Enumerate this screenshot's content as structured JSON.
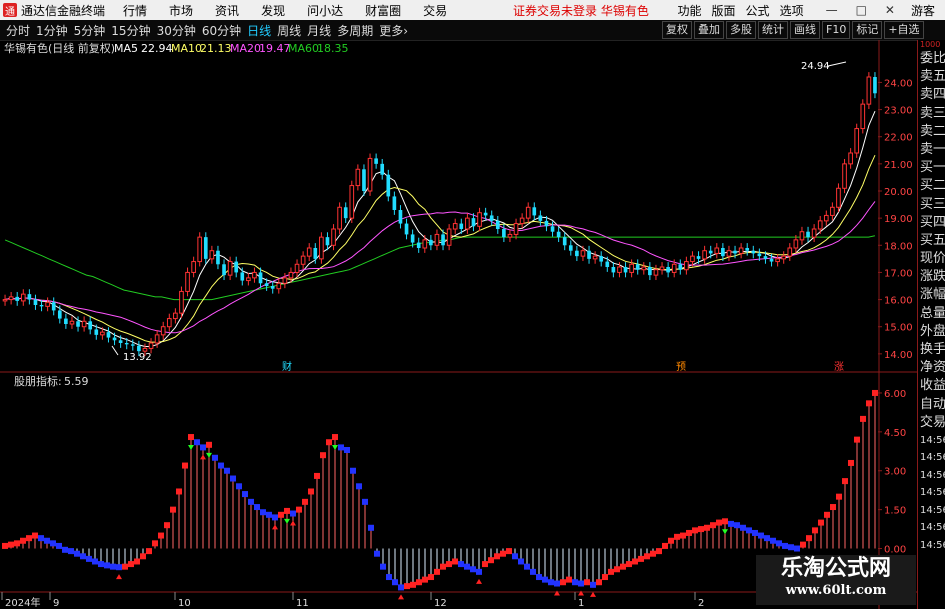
{
  "app": {
    "name": "通达信金融终端",
    "logo": "通"
  },
  "menu": [
    "行情",
    "市场",
    "资讯",
    "发现",
    "问小达",
    "财富圈",
    "交易"
  ],
  "notice": "证券交易未登录  华锡有色",
  "right_menu": [
    "功能",
    "版面",
    "公式",
    "选项"
  ],
  "window_controls": [
    "—",
    "□",
    "✕"
  ],
  "guest": "游客",
  "periods": [
    "分时",
    "1分钟",
    "5分钟",
    "15分钟",
    "30分钟",
    "60分钟",
    "日线",
    "周线",
    "月线",
    "多周期",
    "更多›"
  ],
  "active_period": "日线",
  "tool_buttons": [
    "复权",
    "叠加",
    "多股",
    "统计",
    "画线",
    "F10",
    "标记",
    "+自选"
  ],
  "sidebar": [
    "委比",
    "卖五",
    "卖四",
    "卖三",
    "卖二",
    "卖一",
    "买一",
    "买二",
    "买三",
    "买四",
    "买五",
    "现价",
    "涨跌",
    "涨幅",
    "总量",
    "外盘",
    "换手",
    "净资",
    "收益",
    "自动",
    "交易",
    "14:56",
    "14:56",
    "14:56",
    "14:56",
    "14:56",
    "14:56",
    "14:56"
  ],
  "sidebar_top": "1000",
  "watermark": {
    "line1": "乐淘公式网",
    "line2": "www.60lt.com"
  },
  "colors": {
    "up": "#ff3333",
    "down": "#22ddff",
    "ma5": "#ffffff",
    "ma10": "#ffff66",
    "ma20": "#ff55ff",
    "ma60": "#22cc22",
    "frame": "#8a1a1a",
    "blue_bar": "#2233ff",
    "green_arrow": "#22ff22"
  },
  "chart_data": [
    {
      "type": "candlestick",
      "title": "华锡有色(日线 前复权)",
      "legend": [
        {
          "name": "MA5",
          "value": "22.94"
        },
        {
          "name": "MA10",
          "value": "21.13"
        },
        {
          "name": "MA20",
          "value": "19.47"
        },
        {
          "name": "MA60",
          "value": "18.35"
        }
      ],
      "y_ticks": [
        "24.00",
        "23.00",
        "22.00",
        "21.00",
        "20.00",
        "19.00",
        "18.00",
        "17.00",
        "16.00",
        "15.00",
        "14.00"
      ],
      "ylim": [
        13.7,
        24.9
      ],
      "annotations": {
        "high": "24.94",
        "low": "13.92",
        "markers": [
          "财",
          "预",
          "涨"
        ]
      },
      "close": [
        16.0,
        16.1,
        15.95,
        16.2,
        16.0,
        15.8,
        15.75,
        15.9,
        15.6,
        15.3,
        15.1,
        15.2,
        15.0,
        15.2,
        14.9,
        14.7,
        14.8,
        14.6,
        14.5,
        14.4,
        14.35,
        14.3,
        14.1,
        14.2,
        14.4,
        14.7,
        15.0,
        15.3,
        15.5,
        16.3,
        17.0,
        17.4,
        18.3,
        17.5,
        17.8,
        17.3,
        16.9,
        17.4,
        17.0,
        16.7,
        16.8,
        17.0,
        16.6,
        16.5,
        16.4,
        16.6,
        16.8,
        17.0,
        17.3,
        17.6,
        17.9,
        17.5,
        18.3,
        18.0,
        18.6,
        19.4,
        19.0,
        20.2,
        20.8,
        20.0,
        21.2,
        21.0,
        20.6,
        19.8,
        19.3,
        18.8,
        18.4,
        18.1,
        17.9,
        18.2,
        18.0,
        18.4,
        18.0,
        18.6,
        18.8,
        18.6,
        19.0,
        18.7,
        19.2,
        19.1,
        18.9,
        18.6,
        18.3,
        18.4,
        18.8,
        19.0,
        19.4,
        19.1,
        18.9,
        18.7,
        18.5,
        18.3,
        18.0,
        17.8,
        17.6,
        17.8,
        17.5,
        17.6,
        17.4,
        17.2,
        17.0,
        17.2,
        17.0,
        17.3,
        17.1,
        17.2,
        16.9,
        17.1,
        17.2,
        17.0,
        17.3,
        17.1,
        17.4,
        17.6,
        17.5,
        17.8,
        17.7,
        17.9,
        17.6,
        17.8,
        17.7,
        17.9,
        17.8,
        17.7,
        17.6,
        17.5,
        17.4,
        17.5,
        17.6,
        17.9,
        18.2,
        18.5,
        18.3,
        18.6,
        18.9,
        19.1,
        19.4,
        20.1,
        21.0,
        21.4,
        22.3,
        23.2,
        24.2,
        23.6
      ],
      "ma60": [
        18.2,
        18.1,
        18.0,
        17.9,
        17.8,
        17.7,
        17.6,
        17.5,
        17.4,
        17.3,
        17.2,
        17.1,
        17.0,
        16.9,
        16.85,
        16.75,
        16.65,
        16.55,
        16.45,
        16.35,
        16.3,
        16.25,
        16.2,
        16.15,
        16.1,
        16.1,
        16.05,
        16.0,
        16.0,
        16.0,
        16.0,
        16.0,
        16.0,
        16.0,
        16.05,
        16.1,
        16.15,
        16.2,
        16.25,
        16.3,
        16.35,
        16.4,
        16.45,
        16.5,
        16.55,
        16.6,
        16.65,
        16.7,
        16.75,
        16.8,
        16.85,
        16.9,
        16.95,
        17.0,
        17.05,
        17.1,
        17.2,
        17.3,
        17.4,
        17.5,
        17.6,
        17.7,
        17.8,
        17.9,
        17.95,
        18.0,
        18.05,
        18.1,
        18.1,
        18.15,
        18.2,
        18.2,
        18.25,
        18.3,
        18.3,
        18.3,
        18.3,
        18.3,
        18.3,
        18.3,
        18.3,
        18.3,
        18.3,
        18.3,
        18.3,
        18.3,
        18.3,
        18.3,
        18.3,
        18.3,
        18.3,
        18.3,
        18.3,
        18.3,
        18.3,
        18.3,
        18.3,
        18.3,
        18.3,
        18.3,
        18.3,
        18.3,
        18.3,
        18.3,
        18.3,
        18.3,
        18.3,
        18.3,
        18.3,
        18.3,
        18.3,
        18.3,
        18.3,
        18.3,
        18.3,
        18.3,
        18.3,
        18.3,
        18.3,
        18.3,
        18.3,
        18.3,
        18.3,
        18.3,
        18.3,
        18.3,
        18.3,
        18.3,
        18.3,
        18.3,
        18.3,
        18.3,
        18.3,
        18.3,
        18.3,
        18.3,
        18.3,
        18.3,
        18.3,
        18.35
      ]
    },
    {
      "type": "bar",
      "title": "股朋指标",
      "value": "5.59",
      "y_ticks": [
        "6.00",
        "4.50",
        "3.00",
        "1.50",
        "0.00"
      ],
      "ylim": [
        -1.6,
        6.5
      ],
      "x_labels": [
        "2024年",
        "9",
        "10",
        "11",
        "12",
        "1",
        "2"
      ],
      "values": [
        0.1,
        0.15,
        0.2,
        0.3,
        0.4,
        0.5,
        0.4,
        0.3,
        0.2,
        0.1,
        -0.05,
        -0.1,
        -0.2,
        -0.3,
        -0.4,
        -0.5,
        -0.6,
        -0.65,
        -0.7,
        -0.72,
        -0.7,
        -0.6,
        -0.5,
        -0.3,
        -0.1,
        0.2,
        0.5,
        0.9,
        1.5,
        2.2,
        3.2,
        4.3,
        4.1,
        3.9,
        4.0,
        3.5,
        3.2,
        3.0,
        2.7,
        2.4,
        2.1,
        1.8,
        1.6,
        1.4,
        1.3,
        1.2,
        1.3,
        1.45,
        1.35,
        1.5,
        1.8,
        2.2,
        2.8,
        3.6,
        4.1,
        4.3,
        3.9,
        3.8,
        3.0,
        2.4,
        1.8,
        0.8,
        -0.2,
        -0.7,
        -1.1,
        -1.3,
        -1.5,
        -1.45,
        -1.4,
        -1.3,
        -1.2,
        -1.1,
        -0.9,
        -0.7,
        -0.6,
        -0.5,
        -0.6,
        -0.7,
        -0.8,
        -0.9,
        -0.6,
        -0.45,
        -0.3,
        -0.2,
        -0.1,
        -0.3,
        -0.5,
        -0.7,
        -0.9,
        -1.1,
        -1.2,
        -1.3,
        -1.35,
        -1.3,
        -1.2,
        -1.3,
        -1.35,
        -1.3,
        -1.4,
        -1.3,
        -1.1,
        -0.9,
        -0.8,
        -0.7,
        -0.6,
        -0.5,
        -0.4,
        -0.3,
        -0.2,
        -0.1,
        0.1,
        0.3,
        0.45,
        0.5,
        0.6,
        0.7,
        0.75,
        0.8,
        0.9,
        1.0,
        1.05,
        0.95,
        0.9,
        0.8,
        0.7,
        0.6,
        0.5,
        0.4,
        0.3,
        0.2,
        0.1,
        0.05,
        0.0,
        0.15,
        0.4,
        0.7,
        1.0,
        1.3,
        1.6,
        2.0,
        2.6,
        3.3,
        4.2,
        5.0,
        5.6,
        6.0
      ]
    }
  ]
}
